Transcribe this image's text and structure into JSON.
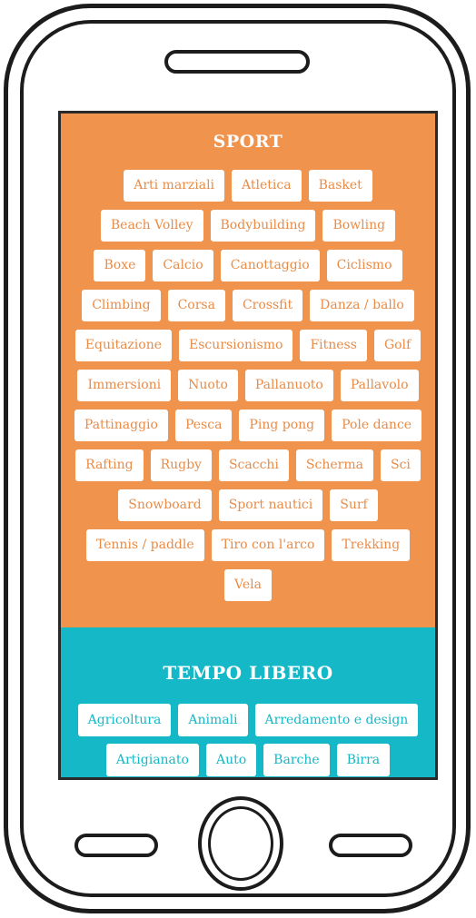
{
  "sport": {
    "title": "SPORT",
    "rows": [
      [
        "Arti marziali",
        "Atletica",
        "Basket"
      ],
      [
        "Beach Volley",
        "Bodybuilding",
        "Bowling"
      ],
      [
        "Boxe",
        "Calcio",
        "Canottaggio",
        "Ciclismo"
      ],
      [
        "Climbing",
        "Corsa",
        "Crossfit",
        "Danza / ballo"
      ],
      [
        "Equitazione",
        "Escursionismo",
        "Fitness",
        "Golf"
      ],
      [
        "Immersioni",
        "Nuoto",
        "Pallanuoto",
        "Pallavolo"
      ],
      [
        "Pattinaggio",
        "Pesca",
        "Ping pong",
        "Pole dance"
      ],
      [
        "Rafting",
        "Rugby",
        "Scacchi",
        "Scherma",
        "Sci"
      ],
      [
        "Snowboard",
        "Sport nautici",
        "Surf"
      ],
      [
        "Tennis / paddle",
        "Tiro con l'arco",
        "Trekking"
      ],
      [
        "Vela"
      ]
    ]
  },
  "tempo_libero": {
    "title": "TEMPO LIBERO",
    "rows": [
      [
        "Agricoltura",
        "Animali",
        "Arredamento e design"
      ],
      [
        "Artigianato",
        "Auto",
        "Barche",
        "Birra"
      ]
    ]
  },
  "colors": {
    "sport_bg": "#f0934d",
    "sport_text": "#e88c48",
    "tempo_bg": "#14b8c7",
    "tempo_text": "#14b8c7"
  }
}
